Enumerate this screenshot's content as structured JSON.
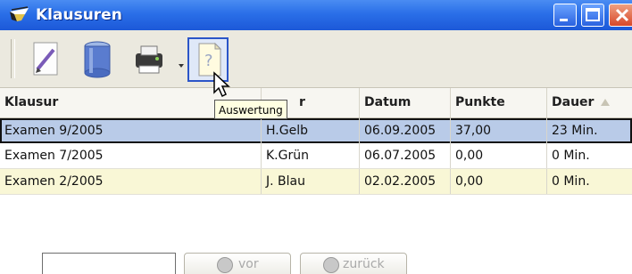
{
  "window": {
    "title": "Klausuren"
  },
  "toolbar": {
    "buttons": [
      {
        "icon": "edit-document-icon"
      },
      {
        "icon": "database-icon"
      },
      {
        "icon": "printer-icon"
      },
      {
        "icon": "help-document-icon"
      }
    ],
    "tooltip": "Auswertung"
  },
  "table": {
    "columns": [
      "Klausur",
      "r",
      "Datum",
      "Punkte",
      "Dauer"
    ],
    "rows": [
      [
        "Examen 9/2005",
        "H.Gelb",
        "06.09.2005",
        "37,00",
        "23 Min."
      ],
      [
        "Examen 7/2005",
        "K.Grün",
        "06.07.2005",
        "0,00",
        "0 Min."
      ],
      [
        "Examen 2/2005",
        "J. Blau",
        "02.02.2005",
        "0,00",
        "0 Min."
      ]
    ]
  },
  "footer": {
    "input_value": "",
    "next_label": "vor",
    "back_label": "zurück"
  }
}
